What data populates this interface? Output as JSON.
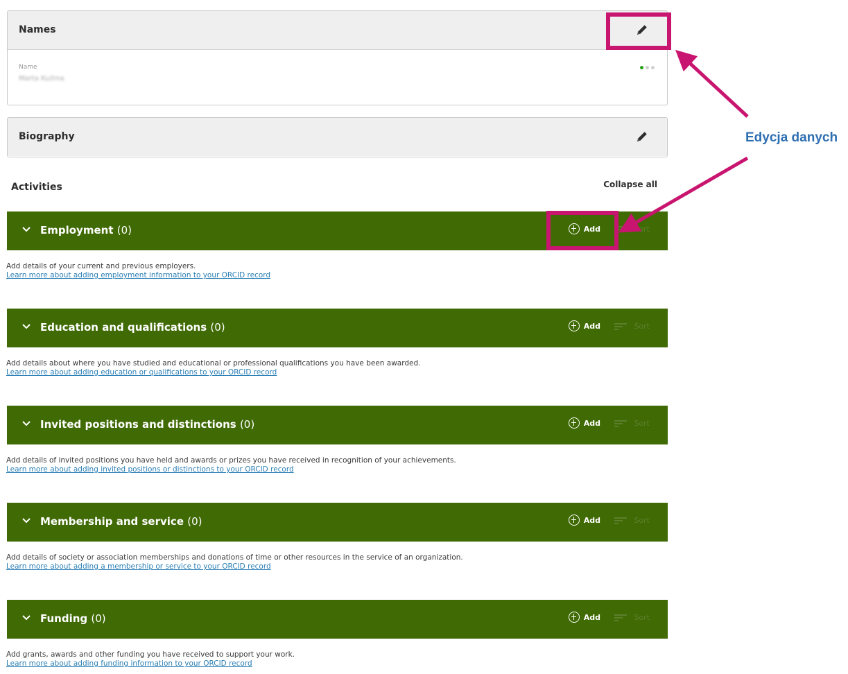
{
  "names": {
    "title": "Names",
    "field_label": "Name",
    "field_value": "Marta Kuźma",
    "visibility": "public"
  },
  "biography": {
    "title": "Biography"
  },
  "activities": {
    "title": "Activities",
    "collapse_all": "Collapse all",
    "add_label": "Add",
    "sort_label": "Sort",
    "sections": [
      {
        "title": "Employment",
        "count": "(0)",
        "description": "Add details of your current and previous employers.",
        "link": "Learn more about adding employment information to your ORCID record"
      },
      {
        "title": "Education and qualifications",
        "count": "(0)",
        "description": "Add details about where you have studied and educational or professional qualifications you have been awarded.",
        "link": "Learn more about adding education or qualifications to your ORCID record"
      },
      {
        "title": "Invited positions and distinctions",
        "count": "(0)",
        "description": "Add details of invited positions you have held and awards or prizes you have received in recognition of your achievements.",
        "link": "Learn more about adding invited positions or distinctions to your ORCID record"
      },
      {
        "title": "Membership and service",
        "count": "(0)",
        "description": "Add details of society or association memberships and donations of time or other resources in the service of an organization.",
        "link": "Learn more about adding a membership or service to your ORCID record"
      },
      {
        "title": "Funding",
        "count": "(0)",
        "description": "Add grants, awards and other funding you have received to support your work.",
        "link": "Learn more about adding funding information to your ORCID record"
      }
    ]
  },
  "annotation": {
    "text": "Edycja danych",
    "color": "#2e6fb2",
    "highlight_color": "#c8156f"
  },
  "colors": {
    "section_bar": "#3f6a04",
    "link": "#2a7fb5",
    "panel_header": "#efefef"
  }
}
